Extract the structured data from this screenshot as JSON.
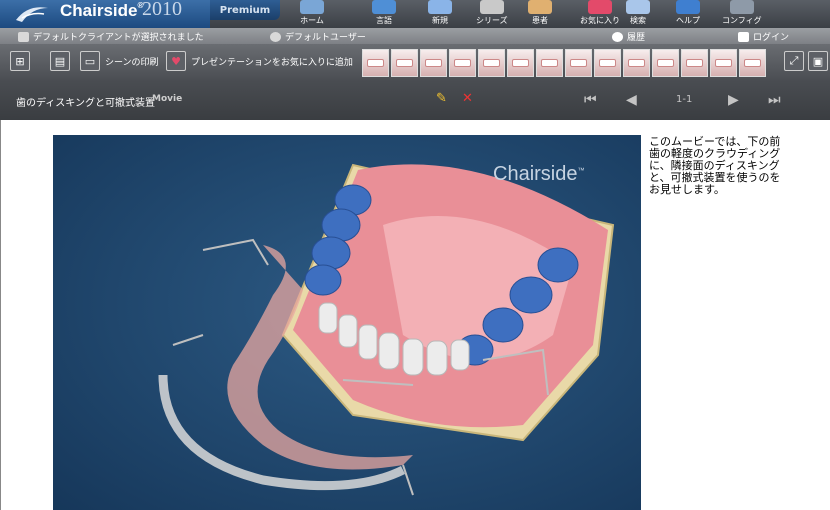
{
  "app": {
    "brand": "Chairside",
    "registered": "®",
    "year": "2010",
    "edition": "Premium"
  },
  "nav": [
    {
      "label": "ホーム",
      "icon": "home-icon",
      "color": "#7aa6d6"
    },
    {
      "label": "言語",
      "icon": "language-icon",
      "color": "#4f8fd6"
    },
    {
      "label": "新規",
      "icon": "new-icon",
      "color": "#8ab4e8"
    },
    {
      "label": "シリーズ",
      "icon": "series-icon",
      "color": "#c9c9c9"
    },
    {
      "label": "患者",
      "icon": "patient-icon",
      "color": "#e0b070"
    },
    {
      "label": "お気に入り",
      "icon": "favorites-icon",
      "color": "#e34a6a"
    },
    {
      "label": "検索",
      "icon": "search-icon",
      "color": "#a9c6ea"
    },
    {
      "label": "ヘルプ",
      "icon": "help-icon",
      "color": "#3f7fd0"
    },
    {
      "label": "コンフィグ",
      "icon": "config-icon",
      "color": "#8e9aa8"
    }
  ],
  "status": {
    "client": "デフォルトクライアントが選択されました",
    "user": "デフォルトユーザー",
    "history": "履歴",
    "login": "ログイン"
  },
  "toolbar": {
    "print_scene": "シーンの印刷",
    "add_favorite": "プレゼンテーションをお気に入りに追加"
  },
  "thumbnails": [
    "implant",
    "extraction",
    "crown",
    "bridge",
    "denture",
    "rootcanal",
    "orthodontic",
    "bonding",
    "veneer",
    "scaling",
    "gum",
    "brushing",
    "whitening",
    "xray"
  ],
  "scene": {
    "title": "歯のディスキングと可撤式装置",
    "type": "Movie",
    "page_count": "1-1",
    "description": "このムービーでは、下の前歯の軽度のクラウディングに、隣接面のディスキングと、可撤式装置を使うのをお見せします。",
    "watermark": "Chairside",
    "watermark_tm": "™"
  },
  "colors": {
    "gum": "#e98f97",
    "tooth_blue": "#3e6fc0",
    "tooth_white": "#ececec",
    "base": "#e9d9a8",
    "appliance": "#e8a7a0"
  }
}
